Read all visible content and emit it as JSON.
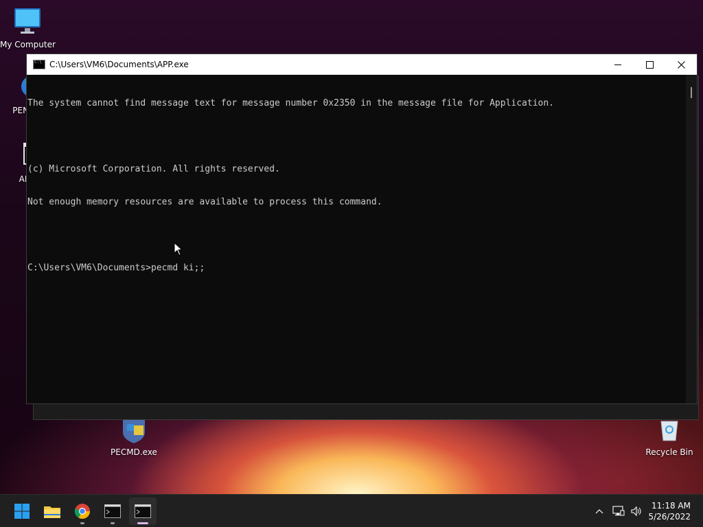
{
  "desktop": {
    "icons": [
      {
        "label": "My Computer"
      },
      {
        "label": "PENetw"
      },
      {
        "label": "APP"
      },
      {
        "label": "PECMD.exe"
      },
      {
        "label": "Recycle Bin"
      }
    ]
  },
  "console": {
    "title": "C:\\Users\\VM6\\Documents\\APP.exe",
    "lines": [
      "The system cannot find message text for message number 0x2350 in the message file for Application.",
      "",
      "(c) Microsoft Corporation. All rights reserved.",
      "Not enough memory resources are available to process this command.",
      "",
      "C:\\Users\\VM6\\Documents>pecmd ki;;"
    ]
  },
  "taskbar": {
    "clock_time": "11:18 AM",
    "clock_date": "5/26/2022"
  },
  "colors": {
    "console_bg": "#0c0c0c",
    "console_text": "#cccccc",
    "taskbar_bg": "#202020",
    "windows_blue": "#1e90ff"
  }
}
